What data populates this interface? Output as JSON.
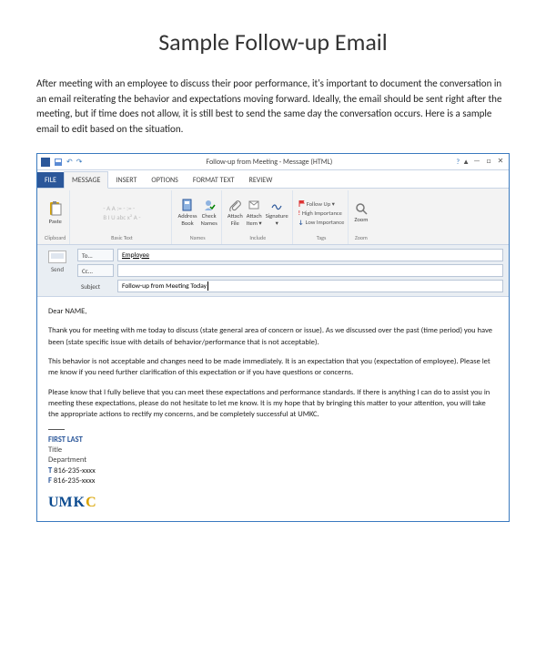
{
  "page": {
    "title": "Sample Follow-up Email",
    "intro": "After meeting with an employee to discuss their poor performance, it's important to document the conversation in an email reiterating the behavior and expectations moving forward. Ideally, the email should be sent right after the meeting, but if time does not allow, it is still best to send the same day the conversation occurs. Here is a sample email to edit based on the situation."
  },
  "outlook": {
    "titlebar": "Follow-up from Meeting - Message (HTML)",
    "tabs": {
      "file": "FILE",
      "message": "MESSAGE",
      "insert": "INSERT",
      "options": "OPTIONS",
      "format": "FORMAT TEXT",
      "review": "REVIEW"
    },
    "ribbon": {
      "clipboard": {
        "paste": "Paste",
        "label": "Clipboard"
      },
      "basic_text": {
        "sample": "- A A  := - := -\nB  I  U  abc  x²  A -",
        "label": "Basic Text"
      },
      "names": {
        "address": "Address\nBook",
        "check": "Check\nNames",
        "label": "Names"
      },
      "include": {
        "attach_file": "Attach\nFile",
        "attach_item": "Attach\nItem ▾",
        "signature": "Signature\n▾",
        "label": "Include"
      },
      "tags": {
        "follow_up": "Follow Up ▾",
        "high": "High Importance",
        "low": "Low Importance",
        "label": "Tags"
      },
      "zoom": {
        "zoom": "Zoom",
        "label": "Zoom"
      }
    },
    "header": {
      "send": "Send",
      "to_btn": "To...",
      "to_val": "Employee",
      "cc_btn": "Cc...",
      "cc_val": "",
      "subj_lbl": "Subject",
      "subj_val": "Follow-up from Meeting Today"
    },
    "body": {
      "greeting": "Dear NAME,",
      "p1": "Thank you for meeting with me today to discuss (state general area of concern or issue). As we discussed over the past (time period) you have been (state specific issue with details of behavior/performance that is not acceptable).",
      "p2": "This behavior is not acceptable and changes need to be made immediately. It is an expectation that you (expectation of employee). Please let me know if you need further clarification of this expectation or if you have questions or concerns.",
      "p3": "Please know that I fully believe that you can meet these expectations and performance standards. If there is anything I can do to assist you in meeting these expectations, please do not hesitate to let me know. It is my hope that by bringing this matter to your attention, you will take the appropriate actions to rectify my concerns, and be completely successful at UMKC."
    },
    "signature": {
      "name": "FIRST LAST",
      "title": "Title",
      "dept": "Department",
      "phone_lbl": "T",
      "phone": "816-235-xxxx",
      "fax_lbl": "F",
      "fax": "816-235-xxxx",
      "logo": "UMKC"
    }
  }
}
